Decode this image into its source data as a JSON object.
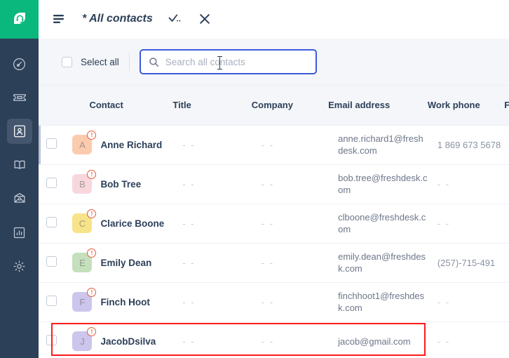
{
  "brand": {
    "logo_icon": "headset-leaf-logo",
    "logo_color": "#0ab87d",
    "rail_color": "#2c4058",
    "accent_color": "#3b5bdb",
    "alert_color": "#e8593a",
    "highlight_color": "#ff1a1a"
  },
  "sidebar": {
    "items": [
      {
        "name": "dashboard",
        "icon": "gauge-icon",
        "active": false
      },
      {
        "name": "tickets",
        "icon": "ticket-icon",
        "active": false
      },
      {
        "name": "contacts",
        "icon": "contact-icon",
        "active": true
      },
      {
        "name": "solutions",
        "icon": "book-icon",
        "active": false
      },
      {
        "name": "social",
        "icon": "social-icon",
        "active": false
      },
      {
        "name": "reports",
        "icon": "bar-chart-icon",
        "active": false
      },
      {
        "name": "admin",
        "icon": "gear-icon",
        "active": false
      }
    ]
  },
  "titlebar": {
    "menu_icon": "hamburger-icon",
    "title": "* All contacts",
    "apply_icon": "check-dots-icon",
    "close_icon": "close-icon"
  },
  "toolbar": {
    "select_all_label": "Select all",
    "select_all_checked": false,
    "search": {
      "icon": "search-icon",
      "value": "",
      "placeholder": "Search all contacts",
      "focused": true
    }
  },
  "table": {
    "columns": [
      {
        "key": "contact",
        "label": "Contact"
      },
      {
        "key": "title",
        "label": "Title"
      },
      {
        "key": "company",
        "label": "Company"
      },
      {
        "key": "email",
        "label": "Email address"
      },
      {
        "key": "phone",
        "label": "Work phone"
      },
      {
        "key": "fax",
        "label": "Fa"
      }
    ],
    "empty_value": "- -",
    "rows": [
      {
        "initial": "A",
        "avatar_color": "#fbcbb0",
        "name": "Anne Richard",
        "title": "- -",
        "company": "- -",
        "email": "anne.richard1@freshdesk.com",
        "phone": "1 869 673 5678",
        "fax": "- -",
        "badge": "!",
        "selected": false,
        "marked": true,
        "highlighted": false
      },
      {
        "initial": "B",
        "avatar_color": "#f8d7dc",
        "name": "Bob Tree",
        "title": "- -",
        "company": "- -",
        "email": "bob.tree@freshdesk.com",
        "phone": "- -",
        "fax": "- -",
        "badge": "!",
        "selected": false,
        "marked": false,
        "highlighted": false
      },
      {
        "initial": "C",
        "avatar_color": "#f7e48a",
        "name": "Clarice Boone",
        "title": "- -",
        "company": "- -",
        "email": "clboone@freshdesk.com",
        "phone": "- -",
        "fax": "- -",
        "badge": "!",
        "selected": false,
        "marked": false,
        "highlighted": false
      },
      {
        "initial": "E",
        "avatar_color": "#c5e0bc",
        "name": "Emily Dean",
        "title": "- -",
        "company": "- -",
        "email": "emily.dean@freshdesk.com",
        "phone": "(257)-715-491",
        "fax": "- -",
        "badge": "!",
        "selected": false,
        "marked": false,
        "highlighted": false
      },
      {
        "initial": "F",
        "avatar_color": "#ccc5ec",
        "name": "Finch Hoot",
        "title": "- -",
        "company": "- -",
        "email": "finchhoot1@freshdesk.com",
        "phone": "- -",
        "fax": "- -",
        "badge": "!",
        "selected": false,
        "marked": false,
        "highlighted": false
      },
      {
        "initial": "J",
        "avatar_color": "#ccc5ec",
        "name": "JacobDsilva",
        "title": "- -",
        "company": "- -",
        "email": "jacob@gmail.com",
        "phone": "- -",
        "fax": "- -",
        "badge": "!",
        "selected": false,
        "marked": false,
        "highlighted": true
      }
    ]
  }
}
